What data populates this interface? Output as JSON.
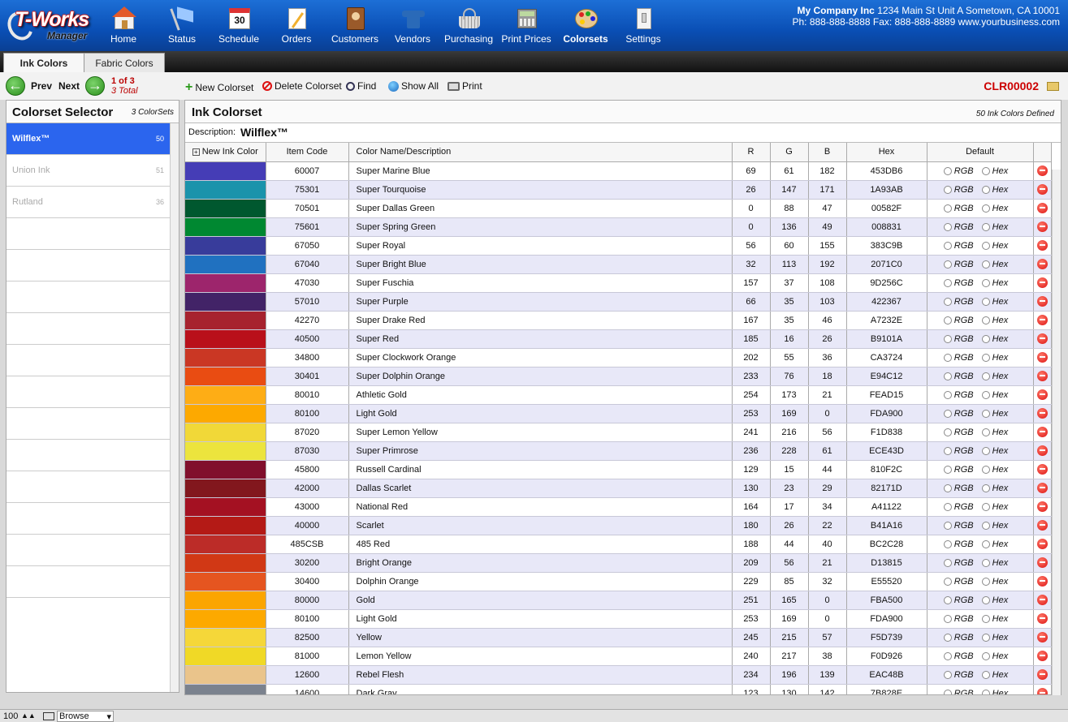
{
  "app": {
    "logo_main": "T-Works",
    "logo_sub": "Manager"
  },
  "nav": [
    {
      "label": "Home",
      "icon": "home-icon"
    },
    {
      "label": "Status",
      "icon": "flag-icon"
    },
    {
      "label": "Schedule",
      "icon": "calendar-icon",
      "badge": "30"
    },
    {
      "label": "Orders",
      "icon": "orders-icon"
    },
    {
      "label": "Customers",
      "icon": "address-book-icon"
    },
    {
      "label": "Vendors",
      "icon": "shirt-icon"
    },
    {
      "label": "Purchasing",
      "icon": "basket-icon"
    },
    {
      "label": "Print Prices",
      "icon": "calculator-icon"
    },
    {
      "label": "Colorsets",
      "icon": "palette-icon"
    },
    {
      "label": "Settings",
      "icon": "switch-icon"
    }
  ],
  "company": {
    "name": "My Company Inc",
    "address": "1234 Main St Unit A Sometown, CA 10001",
    "contact": "Ph: 888-888-8888 Fax: 888-888-8889 www.yourbusiness.com"
  },
  "tabs": [
    {
      "label": "Ink Colors",
      "active": true
    },
    {
      "label": "Fabric Colors",
      "active": false
    }
  ],
  "toolbar": {
    "prev": "Prev",
    "next": "Next",
    "position": "1 of 3",
    "total": "3 Total",
    "new": "New Colorset",
    "delete": "Delete Colorset",
    "find": "Find",
    "show_all": "Show All",
    "print": "Print",
    "record_id": "CLR00002"
  },
  "selector": {
    "title": "Colorset Selector",
    "count": "3 ColorSets",
    "items": [
      {
        "name": "Wilflex™",
        "count": "50"
      },
      {
        "name": "Union Ink",
        "count": "51"
      },
      {
        "name": "Rutland",
        "count": "36"
      }
    ]
  },
  "colorset": {
    "title": "Ink Colorset",
    "defined": "50 Ink Colors Defined",
    "desc_label": "Description:",
    "desc_value": "Wilflex™"
  },
  "table": {
    "headers": [
      "New Ink Color",
      "Item Code",
      "Color Name/Description",
      "R",
      "G",
      "B",
      "Hex",
      "Default"
    ],
    "rgb_label": "RGB",
    "hex_label": "Hex",
    "rows": [
      [
        "60007",
        "Super Marine Blue",
        "69",
        "61",
        "182",
        "453DB6"
      ],
      [
        "75301",
        "Super Tourquoise",
        "26",
        "147",
        "171",
        "1A93AB"
      ],
      [
        "70501",
        "Super Dallas Green",
        "0",
        "88",
        "47",
        "00582F"
      ],
      [
        "75601",
        "Super Spring Green",
        "0",
        "136",
        "49",
        "008831"
      ],
      [
        "67050",
        "Super Royal",
        "56",
        "60",
        "155",
        "383C9B"
      ],
      [
        "67040",
        "Super Bright Blue",
        "32",
        "113",
        "192",
        "2071C0"
      ],
      [
        "47030",
        "Super Fuschia",
        "157",
        "37",
        "108",
        "9D256C"
      ],
      [
        "57010",
        "Super Purple",
        "66",
        "35",
        "103",
        "422367"
      ],
      [
        "42270",
        "Super Drake Red",
        "167",
        "35",
        "46",
        "A7232E"
      ],
      [
        "40500",
        "Super Red",
        "185",
        "16",
        "26",
        "B9101A"
      ],
      [
        "34800",
        "Super Clockwork Orange",
        "202",
        "55",
        "36",
        "CA3724"
      ],
      [
        "30401",
        "Super Dolphin Orange",
        "233",
        "76",
        "18",
        "E94C12"
      ],
      [
        "80010",
        "Athletic Gold",
        "254",
        "173",
        "21",
        "FEAD15"
      ],
      [
        "80100",
        "Light Gold",
        "253",
        "169",
        "0",
        "FDA900"
      ],
      [
        "87020",
        "Super Lemon Yellow",
        "241",
        "216",
        "56",
        "F1D838"
      ],
      [
        "87030",
        "Super Primrose",
        "236",
        "228",
        "61",
        "ECE43D"
      ],
      [
        "45800",
        "Russell Cardinal",
        "129",
        "15",
        "44",
        "810F2C"
      ],
      [
        "42000",
        "Dallas Scarlet",
        "130",
        "23",
        "29",
        "82171D"
      ],
      [
        "43000",
        "National Red",
        "164",
        "17",
        "34",
        "A41122"
      ],
      [
        "40000",
        "Scarlet",
        "180",
        "26",
        "22",
        "B41A16"
      ],
      [
        "485CSB",
        "485 Red",
        "188",
        "44",
        "40",
        "BC2C28"
      ],
      [
        "30200",
        "Bright Orange",
        "209",
        "56",
        "21",
        "D13815"
      ],
      [
        "30400",
        "Dolphin Orange",
        "229",
        "85",
        "32",
        "E55520"
      ],
      [
        "80000",
        "Gold",
        "251",
        "165",
        "0",
        "FBA500"
      ],
      [
        "80100",
        "Light Gold",
        "253",
        "169",
        "0",
        "FDA900"
      ],
      [
        "82500",
        "Yellow",
        "245",
        "215",
        "57",
        "F5D739"
      ],
      [
        "81000",
        "Lemon Yellow",
        "240",
        "217",
        "38",
        "F0D926"
      ],
      [
        "12600",
        "Rebel Flesh",
        "234",
        "196",
        "139",
        "EAC48B"
      ],
      [
        "14600",
        "Dark Gray",
        "123",
        "130",
        "142",
        "7B828E"
      ]
    ]
  },
  "status": {
    "zoom": "100",
    "mode": "Browse"
  }
}
